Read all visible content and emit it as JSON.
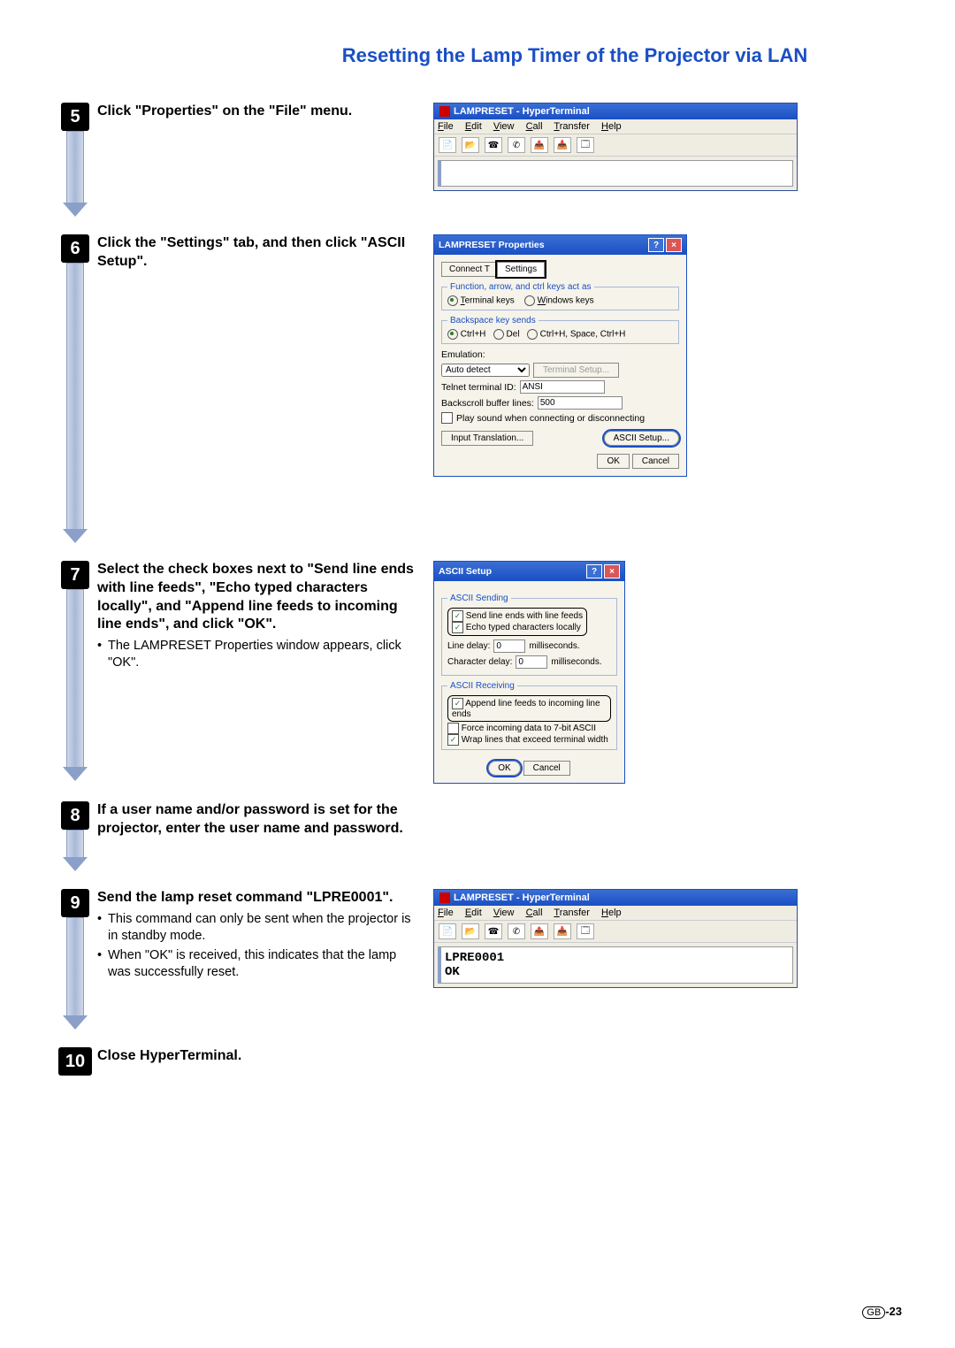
{
  "title": "Resetting the Lamp Timer of the Projector via LAN",
  "footer": {
    "region": "GB",
    "page": "-23"
  },
  "steps": {
    "s5": {
      "num": "5",
      "text": "Click \"Properties\" on the \"File\" menu."
    },
    "s6": {
      "num": "6",
      "text": "Click the \"Settings\" tab, and then click \"ASCII Setup\"."
    },
    "s7": {
      "num": "7",
      "text": "Select the check boxes next to \"Send line ends with line feeds\", \"Echo typed characters locally\", and \"Append line feeds to incoming line ends\", and click \"OK\".",
      "note": "The LAMPRESET Properties window appears, click \"OK\"."
    },
    "s8": {
      "num": "8",
      "text": "If a user name and/or password is set for the projector, enter the user name and password."
    },
    "s9": {
      "num": "9",
      "text": "Send the lamp reset command \"LPRE0001\".",
      "b1": "This command can only be sent when the projector is in standby mode.",
      "b2": "When \"OK\" is received, this indicates that the lamp was successfully reset."
    },
    "s10": {
      "num": "10",
      "text": "Close HyperTerminal."
    }
  },
  "ht": {
    "title": "LAMPRESET - HyperTerminal",
    "menus": {
      "file": "File",
      "edit": "Edit",
      "view": "View",
      "call": "Call",
      "transfer": "Transfer",
      "help": "Help"
    },
    "term_line1": "LPRE0001",
    "term_line2": "OK"
  },
  "propsDialog": {
    "title": "LAMPRESET Properties",
    "tab1": "Connect T",
    "tab2": "Settings",
    "grp1": "Function, arrow, and ctrl keys act as",
    "opt_terminal": "Terminal keys",
    "opt_windows": "Windows keys",
    "grp2": "Backspace key sends",
    "opt_ctrlh": "Ctrl+H",
    "opt_del": "Del",
    "opt_ctrlhs": "Ctrl+H, Space, Ctrl+H",
    "emu_label": "Emulation:",
    "emu_val": "Auto detect",
    "termsetup": "Terminal Setup...",
    "telnet_label": "Telnet terminal ID:",
    "telnet_val": "ANSI",
    "backscroll_label": "Backscroll buffer lines:",
    "backscroll_val": "500",
    "playsound": "Play sound when connecting or disconnecting",
    "input_trans": "Input Translation...",
    "ascii_setup": "ASCII Setup...",
    "ok": "OK",
    "cancel": "Cancel"
  },
  "asciiDialog": {
    "title": "ASCII Setup",
    "grp1": "ASCII Sending",
    "c1": "Send line ends with line feeds",
    "c2": "Echo typed characters locally",
    "line_delay_label": "Line delay:",
    "line_delay_val": "0",
    "line_delay_unit": "milliseconds.",
    "char_delay_label": "Character delay:",
    "char_delay_val": "0",
    "char_delay_unit": "milliseconds.",
    "grp2": "ASCII Receiving",
    "c3": "Append line feeds to incoming line ends",
    "c4": "Force incoming data to 7-bit ASCII",
    "c5": "Wrap lines that exceed terminal width",
    "ok": "OK",
    "cancel": "Cancel"
  }
}
